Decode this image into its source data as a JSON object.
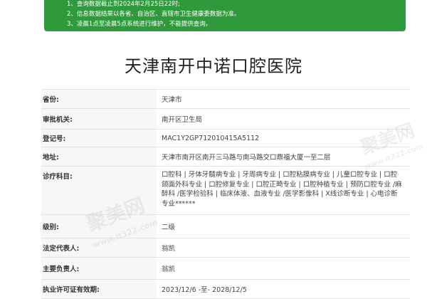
{
  "notice": {
    "lines": [
      "1、查询数据截止到2024年2月25日22时;",
      "2、信息数据结果以各省、自治区、直辖市卫生健康委数据为准。",
      "3、凌晨1点至凌晨5点系统进行维护，不能提供查询。"
    ]
  },
  "hospital": {
    "name": "天津南开中诺口腔医院"
  },
  "table": {
    "rows": [
      {
        "label": "省份:",
        "value": "天津市"
      },
      {
        "label": "审批机关:",
        "value": "南开区卫生局"
      },
      {
        "label": "登记号:",
        "value": "MAC1Y2GP712010415A5112"
      },
      {
        "label": "地址:",
        "value": "天津市南开区南开三马路与南马路交口鼎福大厦一至二层"
      },
      {
        "label": "诊疗科目:",
        "value": "口腔科 | 牙体牙髓病专业 | 牙周病专业 | 口腔粘膜病专业 | 儿童口腔专业 | 口腔颌面外科专业 | 口腔修复专业 | 口腔正畸专业 | 口腔种植专业 | 预防口腔专业 /麻醉科 /医学检验科 | 临床体液、血液专业 /医学影像科 | X线诊断专业 | 心电诊断专业******"
      },
      {
        "label": "级别:",
        "value": "二级"
      },
      {
        "label": "法定代表人:",
        "value": "翁凯"
      },
      {
        "label": "主要负责人:",
        "value": "翁凯"
      },
      {
        "label": "执业许可证有效期:",
        "value": "2023/12/6 -至- 2028/12/5"
      }
    ]
  },
  "watermark": {
    "text_cn": "聚美网",
    "text_url": "www.it322.com"
  }
}
